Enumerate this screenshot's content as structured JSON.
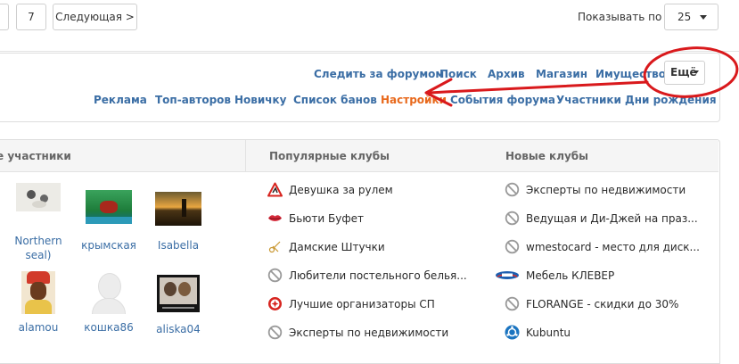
{
  "pagination": {
    "page_number": "7",
    "next_label": "Следующая >"
  },
  "page_size": {
    "label": "Показывать по",
    "value": "25"
  },
  "forum_nav": {
    "row1": [
      "Следить за форумом",
      "Поиск",
      "Архив",
      "Магазин",
      "Имущество"
    ],
    "more_label": "Ещё",
    "row2": [
      "Реклама",
      "Топ-авторов",
      "Новичку",
      "Список банов",
      "Настройки",
      "События форума",
      "Участники",
      "Дни рождения"
    ],
    "active_item": "Настройки"
  },
  "panel": {
    "members_title": "е участники",
    "popular_title": "Популярные клубы",
    "new_title": "Новые клубы",
    "members": [
      {
        "name_line1": "Northern",
        "name_line2": "seal)"
      },
      {
        "name_line1": "крымская",
        "name_line2": ""
      },
      {
        "name_line1": "Isabella",
        "name_line2": ""
      },
      {
        "name_line1": "alamou",
        "name_line2": ""
      },
      {
        "name_line1": "кошка86",
        "name_line2": ""
      },
      {
        "name_line1": "aliska04",
        "name_line2": ""
      }
    ],
    "popular_clubs": [
      {
        "label": "Девушка за рулем",
        "icon": "warning-sign-icon"
      },
      {
        "label": "Бьюти Буфет",
        "icon": "lips-icon"
      },
      {
        "label": "Дамские Штучки",
        "icon": "scissors-icon"
      },
      {
        "label": "Любители постельного белья...",
        "icon": "no-image-icon"
      },
      {
        "label": "Лучшие организаторы СП",
        "icon": "gear-badge-icon"
      },
      {
        "label": "Эксперты по недвижимости",
        "icon": "no-image-icon"
      }
    ],
    "new_clubs": [
      {
        "label": "Эксперты по недвижимости",
        "icon": "no-image-icon"
      },
      {
        "label": "Ведущая и Ди-Джей на праз...",
        "icon": "no-image-icon"
      },
      {
        "label": "wmestocard - место для диск...",
        "icon": "no-image-icon"
      },
      {
        "label": "Мебель КЛЕВЕР",
        "icon": "klever-logo-icon"
      },
      {
        "label": "FLORANGE - скидки до 30%",
        "icon": "no-image-icon"
      },
      {
        "label": "Kubuntu",
        "icon": "kubuntu-logo-icon"
      }
    ]
  },
  "colors": {
    "link": "#3b6ea5",
    "active": "#e8691c",
    "annotation": "#d9191c"
  }
}
